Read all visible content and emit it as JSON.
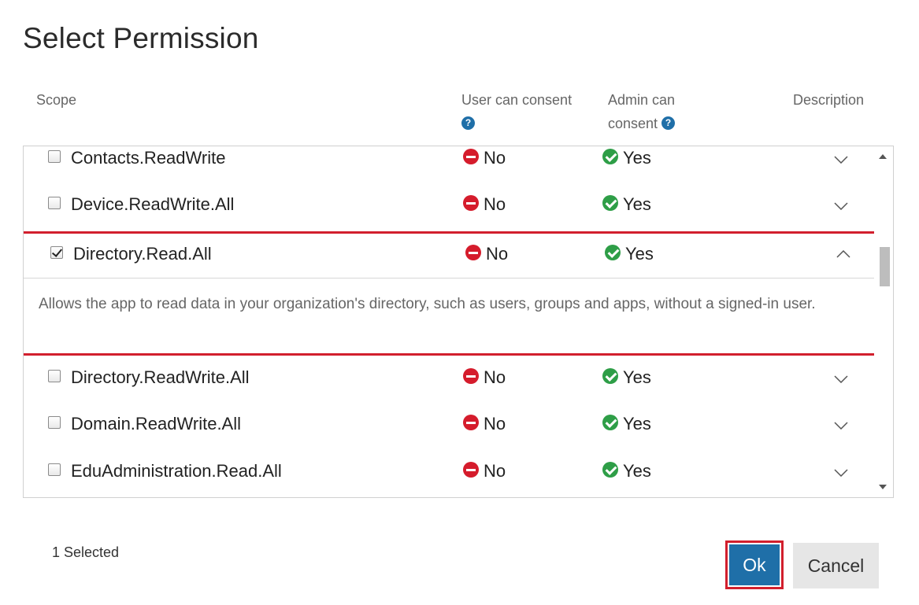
{
  "dialog": {
    "title": "Select Permission"
  },
  "columns": {
    "scope": "Scope",
    "user_consent_line1": "User can consent",
    "admin_consent_line1": "Admin can",
    "admin_consent_line2": "consent",
    "description": "Description"
  },
  "permissions": [
    {
      "scope": "Contacts.ReadWrite",
      "user_consent": "No",
      "admin_consent": "Yes",
      "checked": false,
      "expanded": false
    },
    {
      "scope": "Device.ReadWrite.All",
      "user_consent": "No",
      "admin_consent": "Yes",
      "checked": false,
      "expanded": false
    },
    {
      "scope": "Directory.Read.All",
      "user_consent": "No",
      "admin_consent": "Yes",
      "checked": true,
      "expanded": true,
      "description": "Allows the app to read data in your organization's directory, such as users, groups and apps, without a signed-in user."
    },
    {
      "scope": "Directory.ReadWrite.All",
      "user_consent": "No",
      "admin_consent": "Yes",
      "checked": false,
      "expanded": false
    },
    {
      "scope": "Domain.ReadWrite.All",
      "user_consent": "No",
      "admin_consent": "Yes",
      "checked": false,
      "expanded": false
    },
    {
      "scope": "EduAdministration.Read.All",
      "user_consent": "No",
      "admin_consent": "Yes",
      "checked": false,
      "expanded": false
    }
  ],
  "footer": {
    "selected_count": "1 Selected",
    "ok_label": "Ok",
    "cancel_label": "Cancel"
  },
  "icons": {
    "help": "question-circle-icon",
    "no": "minus-circle-icon",
    "yes": "check-circle-icon",
    "expand": "chevron-down-icon",
    "collapse": "chevron-up-icon"
  },
  "colors": {
    "accent": "#1f6fa8",
    "highlight": "#d21f2d",
    "no": "#d51c2c",
    "yes": "#2e9e47"
  }
}
